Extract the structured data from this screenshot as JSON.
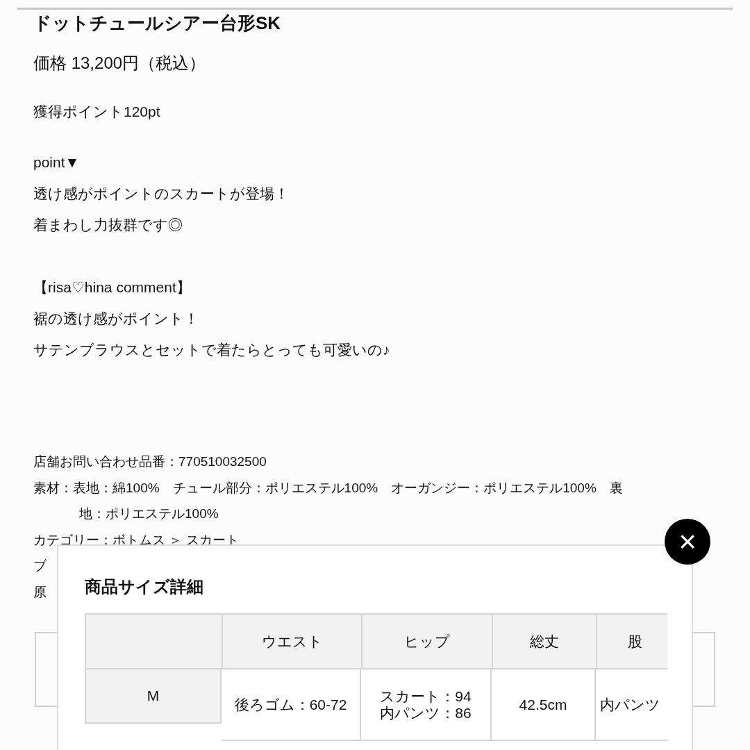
{
  "product": {
    "title": "ドットチュールシアー台形SK",
    "price": "価格 13,200円（税込）",
    "points": "獲得ポイント120pt"
  },
  "description": [
    [
      "point▼",
      "透け感がポイントのスカートが登場！",
      "着まわし力抜群です◎"
    ],
    [
      "【risa♡hina comment】",
      "裾の透け感がポイント！",
      "サテンブラウスとセットで着たらとっても可愛いの♪"
    ]
  ],
  "details": [
    {
      "text": "店舗お問い合わせ品番：770510032500"
    },
    {
      "text": "素材：表地：綿100%　チュール部分：ポリエステル100%　オーガンジー：ポリエステル100%　裏",
      "continuation": "地：ポリエステル100%"
    },
    {
      "text": "カテゴリー：ボトムス ＞ スカート"
    },
    {
      "text": "ブ"
    },
    {
      "text": "原"
    }
  ],
  "size_modal": {
    "title": "商品サイズ詳細",
    "close_symbol": "×",
    "columns": [
      "",
      "ウエスト",
      "ヒップ",
      "総丈",
      "股"
    ],
    "rows": [
      {
        "cells": [
          [
            "M"
          ],
          [
            "後ろゴム：60-72"
          ],
          [
            "スカート：94",
            "内パンツ：86"
          ],
          [
            "42.5cm"
          ],
          [
            "内パンツ"
          ]
        ]
      }
    ]
  }
}
